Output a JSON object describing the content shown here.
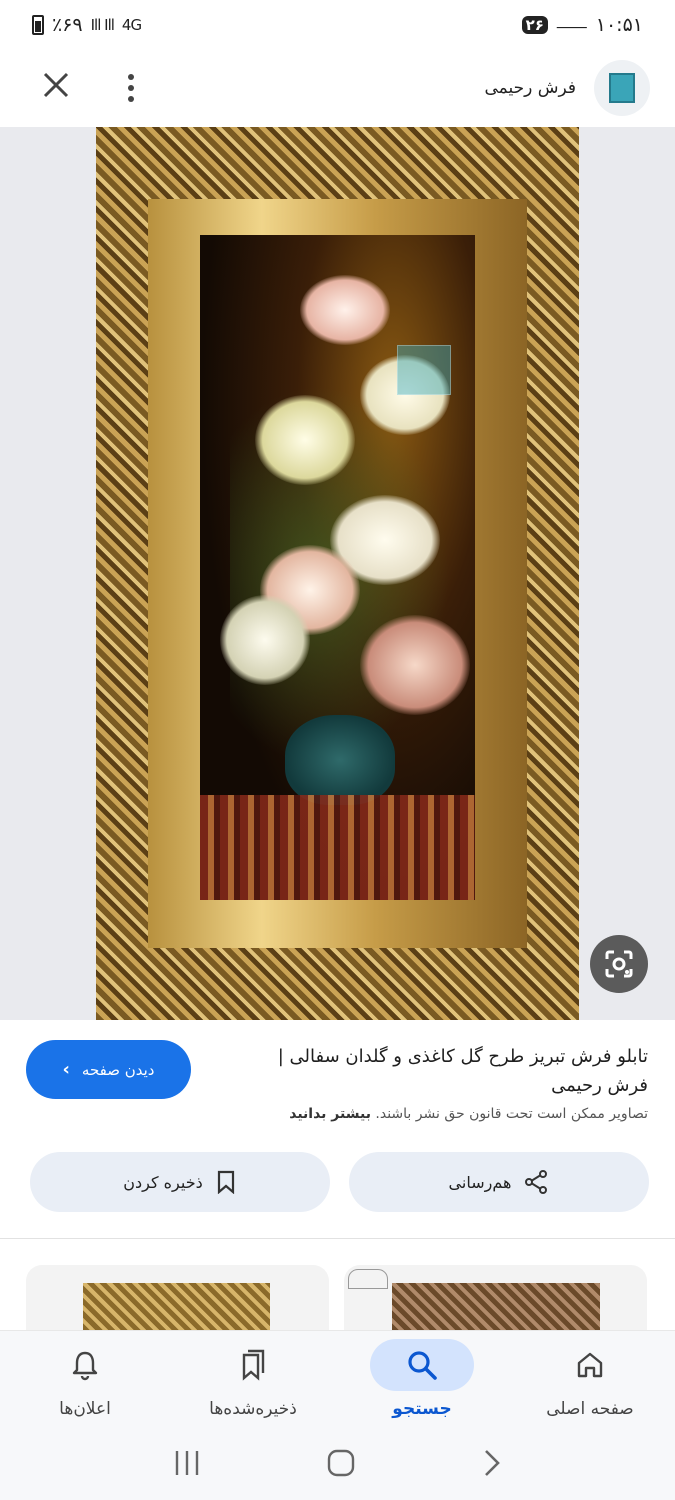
{
  "status_bar": {
    "time": "۱۰:۵۱",
    "calendar_badge": "۲۶",
    "battery": "٪۶۹",
    "network": "4G"
  },
  "header": {
    "site_name": "فرش رحیمی",
    "logo_icon": "rahimi-carpet-logo",
    "close_icon": "close-icon",
    "more_icon": "more-vert-icon"
  },
  "image": {
    "description_icon": "framed-floral-tapestry",
    "lens_icon": "google-lens-icon"
  },
  "info": {
    "title": "تابلو فرش تبریز طرح گل کاغذی و گلدان سفالی | فرش رحیمی",
    "copyright_text": "تصاویر ممکن است تحت قانون حق نشر باشند.",
    "learn_more": "بیشتر بدانید",
    "visit_label": "دیدن صفحه",
    "share_label": "هم‌رسانی",
    "save_label": "ذخیره کردن",
    "accent_color": "#1a73e8"
  },
  "bottom_nav": {
    "items": [
      {
        "label": "صفحه اصلی",
        "icon": "home-icon"
      },
      {
        "label": "جستجو",
        "icon": "search-icon",
        "active": true
      },
      {
        "label": "ذخیره‌شده‌ها",
        "icon": "bookmarks-icon"
      },
      {
        "label": "اعلان‌ها",
        "icon": "bell-icon"
      }
    ]
  },
  "system_nav": {
    "buttons": [
      "back",
      "home",
      "recents"
    ]
  }
}
